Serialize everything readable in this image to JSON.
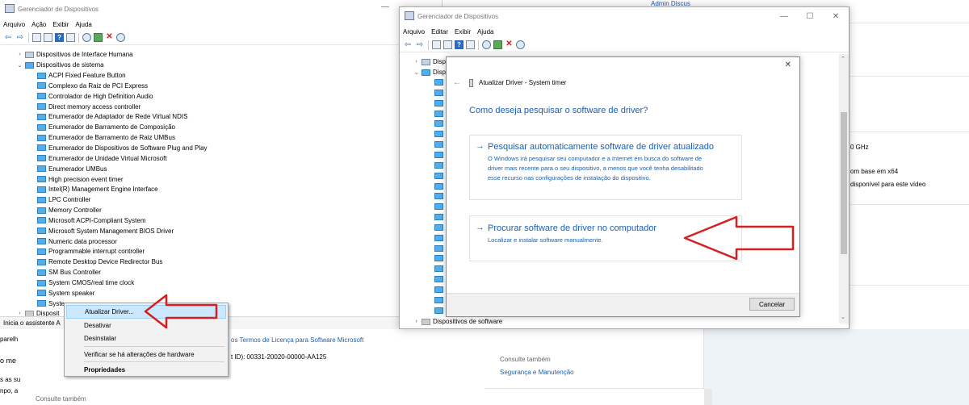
{
  "bg_window": {
    "title": "Gerenciador de Dispositivos",
    "menu": [
      "Arquivo",
      "Ação",
      "Exibir",
      "Ajuda"
    ],
    "minimize_glyph": "—",
    "tree": {
      "category_collapsed_above": "Dispositivos de Interface Humana",
      "category_expanded": "Dispositivos de sistema",
      "devices": [
        "ACPI Fixed Feature Button",
        "Complexo da Raiz de PCI Express",
        "Controlador de High Definition Audio",
        "Direct memory access controller",
        "Enumerador de Adaptador de Rede Virtual NDIS",
        "Enumerador de Barramento de Composição",
        "Enumerador de Barramento de Raiz UMBus",
        "Enumerador de Dispositivos de Software Plug and Play",
        "Enumerador de Unidade Virtual Microsoft",
        "Enumerador UMBus",
        "High precision event timer",
        "Intel(R) Management Engine Interface",
        "LPC Controller",
        "Memory Controller",
        "Microsoft ACPI-Compliant System",
        "Microsoft System Management BIOS Driver",
        "Numeric data processor",
        "Programmable interrupt controller",
        "Remote Desktop Device Redirector Bus",
        "SM Bus Controller",
        "System CMOS/real time clock",
        "System speaker",
        "Syste"
      ],
      "next_category_partial": "Disposit"
    },
    "status_text": "Inicia o assistente A"
  },
  "context_menu": {
    "items": [
      "Atualizar Driver...",
      "Desativar",
      "Desinstalar",
      "Verificar se há alterações de hardware",
      "Propriedades"
    ],
    "highlight_color": "#cce8ff"
  },
  "fg_window": {
    "title": "Gerenciador de Dispositivos",
    "menu": [
      "Arquivo",
      "Editar",
      "Exibir",
      "Ajuda"
    ],
    "tree_partial": [
      "Disp",
      "Disp"
    ],
    "bottom_partial": "Dispositivos de software"
  },
  "dialog": {
    "breadcrumb": "Atualizar Driver - System timer",
    "question": "Como deseja pesquisar o software de driver?",
    "option1": {
      "title": "Pesquisar automaticamente software de driver atualizado",
      "line1": "O Windows irá pesquisar seu computador e a Internet em busca do software de",
      "line2": "driver mais recente para o seu dispositivo, a menos que você tenha desabilitado",
      "line3": "esse recurso nas configurações de instalação do dispositivo."
    },
    "option2": {
      "title": "Procurar software de driver no computador",
      "desc": "Localizar e instalar software manualmente."
    },
    "cancel": "Cancelar",
    "close_glyph": "✕",
    "back_glyph": "←"
  },
  "annotation_color": "#d42020",
  "background_fragments": {
    "top_right_link": "Admin  Discus",
    "spec_ghz": "0 GHz",
    "spec_os": "om base em x64",
    "spec_display": "disponível para este vídeo",
    "license_link": "os Termos de Licença para Software Microsoft",
    "product_id": "t ID): 00331-20020-00000-AA125",
    "left_frag1": "parelh",
    "left_frag2": "o me",
    "left_frag3": "s as su",
    "left_frag4": "npo, a",
    "see_also_1": "Consulte também",
    "see_also_2": "Consulte também",
    "security_link": "Segurança e Manutenção"
  }
}
